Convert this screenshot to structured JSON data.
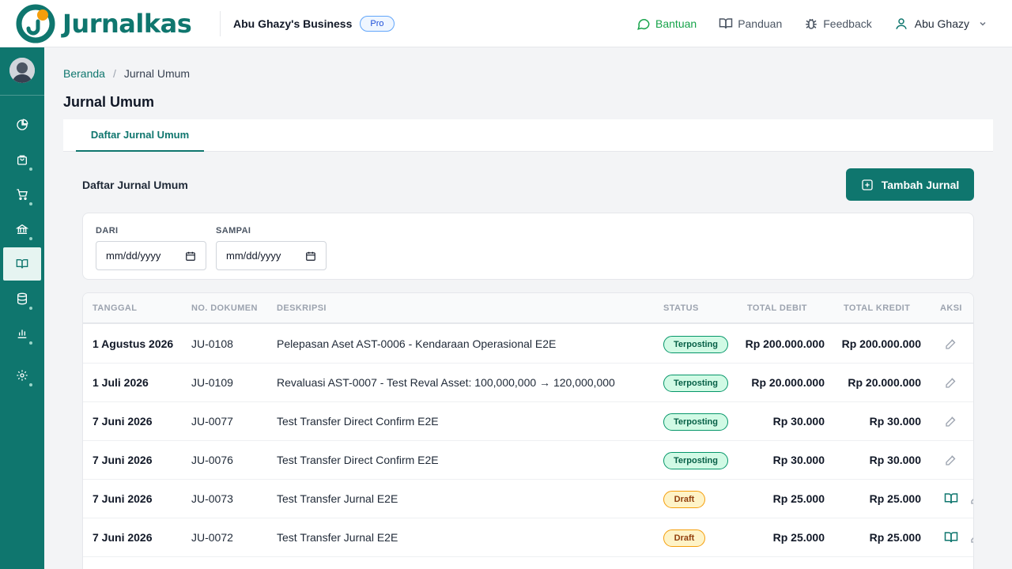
{
  "header": {
    "app_name": "Jurnalkas",
    "business_name": "Abu Ghazy's Business",
    "plan_badge": "Pro",
    "links": {
      "help": "Bantuan",
      "guide": "Panduan",
      "feedback": "Feedback"
    },
    "user_name": "Abu Ghazy",
    "colors": {
      "brand": "#0f766e",
      "help": "#16a34a"
    }
  },
  "sidebar": {
    "items": [
      "dashboard-icon",
      "bag-icon",
      "cart-icon",
      "bank-icon",
      "book-icon",
      "database-icon",
      "chart-icon",
      "settings-icon"
    ],
    "active": "book-icon"
  },
  "breadcrumb": {
    "home": "Beranda",
    "current": "Jurnal Umum"
  },
  "page_title": "Jurnal Umum",
  "tab": "Daftar Jurnal Umum",
  "section_title": "Daftar Jurnal Umum",
  "add_button": "Tambah Jurnal",
  "filters": {
    "from_label": "DARI",
    "from_value": "mm/dd/yyyy",
    "to_label": "SAMPAI",
    "to_value": "mm/dd/yyyy"
  },
  "table": {
    "columns": {
      "date": "TANGGAL",
      "doc": "NO. DOKUMEN",
      "desc": "DESKRIPSI",
      "status": "STATUS",
      "debit": "TOTAL DEBIT",
      "credit": "TOTAL KREDIT",
      "action": "AKSI"
    },
    "rows": [
      {
        "date": "1 Agustus 2026",
        "doc": "JU-0108",
        "desc": "Pelepasan Aset AST-0006 - Kendaraan Operasional E2E",
        "status": "Terposting",
        "debit": "Rp 200.000.000",
        "credit": "Rp 200.000.000"
      },
      {
        "date": "1 Juli 2026",
        "doc": "JU-0109",
        "desc": "Revaluasi AST-0007 - Test Reval Asset: 100,000,000 → 120,000,000",
        "status": "Terposting",
        "debit": "Rp 20.000.000",
        "credit": "Rp 20.000.000"
      },
      {
        "date": "7 Juni 2026",
        "doc": "JU-0077",
        "desc": "Test Transfer Direct Confirm E2E",
        "status": "Terposting",
        "debit": "Rp 30.000",
        "credit": "Rp 30.000"
      },
      {
        "date": "7 Juni 2026",
        "doc": "JU-0076",
        "desc": "Test Transfer Direct Confirm E2E",
        "status": "Terposting",
        "debit": "Rp 30.000",
        "credit": "Rp 30.000"
      },
      {
        "date": "7 Juni 2026",
        "doc": "JU-0073",
        "desc": "Test Transfer Jurnal E2E",
        "status": "Draft",
        "debit": "Rp 25.000",
        "credit": "Rp 25.000"
      },
      {
        "date": "7 Juni 2026",
        "doc": "JU-0072",
        "desc": "Test Transfer Jurnal E2E",
        "status": "Draft",
        "debit": "Rp 25.000",
        "credit": "Rp 25.000"
      }
    ]
  }
}
